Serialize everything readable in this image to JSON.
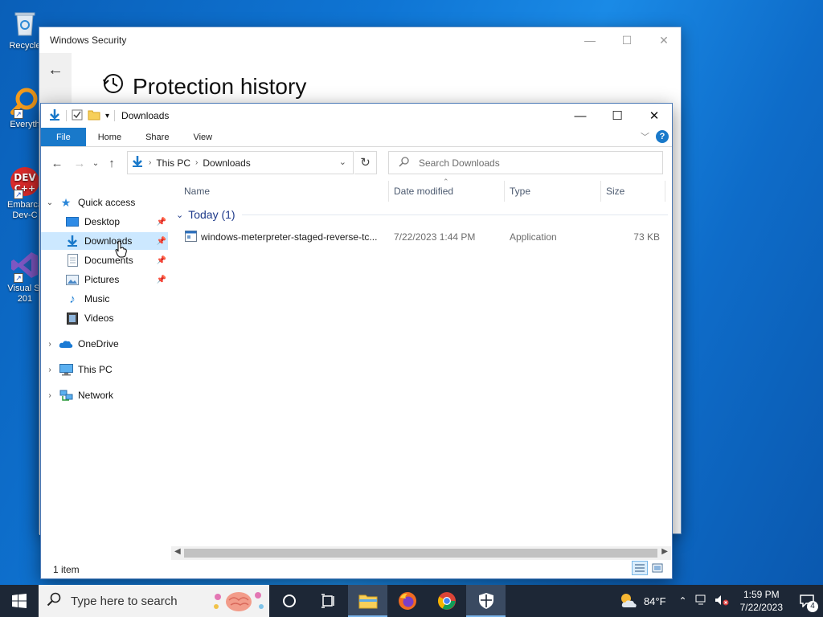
{
  "desktop": {
    "icons": [
      {
        "label": "Recycle",
        "icon": "recycle-bin-icon"
      },
      {
        "label": "Everyth",
        "icon": "everything-search-icon"
      },
      {
        "label": "Embarca\nDev-C",
        "icon": "dev-cpp-icon"
      },
      {
        "label": "Visual St\n201",
        "icon": "visual-studio-icon"
      }
    ]
  },
  "security_window": {
    "title": "Windows Security",
    "heading": "Protection history"
  },
  "explorer": {
    "title": "Downloads",
    "ribbon_tabs": [
      "File",
      "Home",
      "Share",
      "View"
    ],
    "help_label": "?",
    "breadcrumb": [
      "This PC",
      "Downloads"
    ],
    "search_placeholder": "Search Downloads",
    "nav": {
      "quick_access": "Quick access",
      "items": [
        "Desktop",
        "Downloads",
        "Documents",
        "Pictures",
        "Music",
        "Videos"
      ],
      "onedrive": "OneDrive",
      "this_pc": "This PC",
      "network": "Network"
    },
    "columns": [
      "Name",
      "Date modified",
      "Type",
      "Size"
    ],
    "group_label": "Today (1)",
    "files": [
      {
        "name": "windows-meterpreter-staged-reverse-tc...",
        "date": "7/22/2023 1:44 PM",
        "type": "Application",
        "size": "73 KB"
      }
    ],
    "status": "1 item"
  },
  "taskbar": {
    "search_placeholder": "Type here to search",
    "weather": "84°F",
    "time": "1:59 PM",
    "date": "7/22/2023",
    "notification_count": "4"
  },
  "colors": {
    "accent": "#1979ca",
    "selection": "#cce8ff",
    "taskbar": "#1d2736"
  }
}
